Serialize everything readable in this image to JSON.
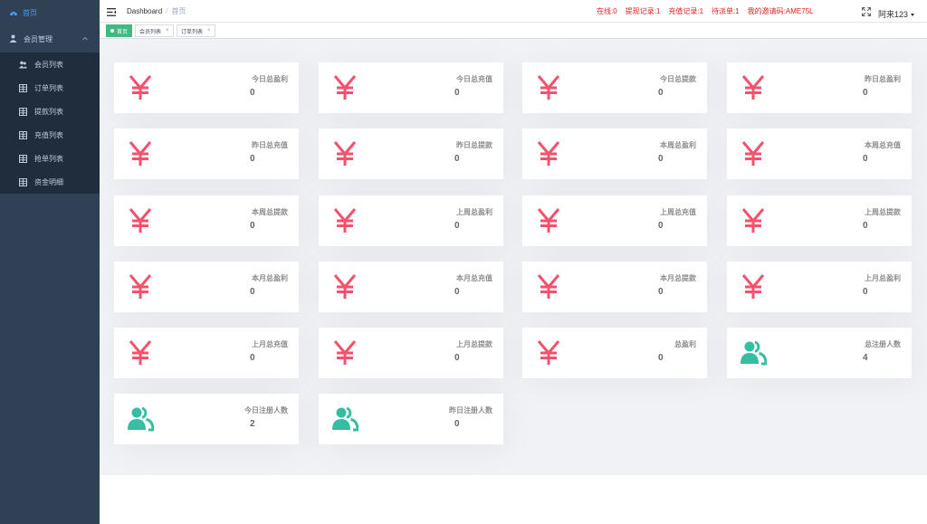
{
  "sidebar": {
    "home": "首页",
    "group": "会员管理",
    "items": [
      {
        "label": "会员列表",
        "icon": "users-icon"
      },
      {
        "label": "订单列表",
        "icon": "table-icon"
      },
      {
        "label": "提款列表",
        "icon": "table-icon"
      },
      {
        "label": "充值列表",
        "icon": "table-icon"
      },
      {
        "label": "抢单列表",
        "icon": "table-icon"
      },
      {
        "label": "资金明细",
        "icon": "table-icon"
      }
    ]
  },
  "navbar": {
    "breadcrumb_root": "Dashboard",
    "breadcrumb_sep": "/",
    "breadcrumb_current": "首页",
    "notices": [
      "在线:0",
      "提现记录:1",
      "充值记录:1",
      "待派单:1",
      "我的邀请码:AME75L"
    ],
    "user": "阿来123"
  },
  "tags": [
    {
      "label": "首页",
      "active": true
    },
    {
      "label": "会员列表",
      "close": "×"
    },
    {
      "label": "订单列表",
      "close": "×"
    }
  ],
  "cards": [
    {
      "label": "今日总盈利",
      "value": "0",
      "icon": "yen-icon"
    },
    {
      "label": "今日总充值",
      "value": "0",
      "icon": "yen-icon"
    },
    {
      "label": "今日总提款",
      "value": "0",
      "icon": "yen-icon"
    },
    {
      "label": "昨日总盈利",
      "value": "0",
      "icon": "yen-icon"
    },
    {
      "label": "昨日总充值",
      "value": "0",
      "icon": "yen-icon"
    },
    {
      "label": "昨日总提款",
      "value": "0",
      "icon": "yen-icon"
    },
    {
      "label": "本周总盈利",
      "value": "0",
      "icon": "yen-icon"
    },
    {
      "label": "本周总充值",
      "value": "0",
      "icon": "yen-icon"
    },
    {
      "label": "本周总提款",
      "value": "0",
      "icon": "yen-icon"
    },
    {
      "label": "上周总盈利",
      "value": "0",
      "icon": "yen-icon"
    },
    {
      "label": "上周总充值",
      "value": "0",
      "icon": "yen-icon"
    },
    {
      "label": "上周总提款",
      "value": "0",
      "icon": "yen-icon"
    },
    {
      "label": "本月总盈利",
      "value": "0",
      "icon": "yen-icon"
    },
    {
      "label": "本月总充值",
      "value": "0",
      "icon": "yen-icon"
    },
    {
      "label": "本月总提款",
      "value": "0",
      "icon": "yen-icon"
    },
    {
      "label": "上月总盈利",
      "value": "0",
      "icon": "yen-icon"
    },
    {
      "label": "上月总充值",
      "value": "0",
      "icon": "yen-icon"
    },
    {
      "label": "上月总提款",
      "value": "0",
      "icon": "yen-icon"
    },
    {
      "label": "总盈利",
      "value": "0",
      "icon": "yen-icon"
    },
    {
      "label": "总注册人数",
      "value": "4",
      "icon": "people-icon"
    },
    {
      "label": "今日注册人数",
      "value": "2",
      "icon": "people-icon"
    },
    {
      "label": "昨日注册人数",
      "value": "0",
      "icon": "people-icon"
    }
  ],
  "colors": {
    "yen": "#f4516c",
    "people": "#34bfa3",
    "sidebar_bg": "#304156",
    "sidebar_sub_bg": "#1f2d3d",
    "tag_active": "#42b983",
    "notice": "#e02020"
  }
}
